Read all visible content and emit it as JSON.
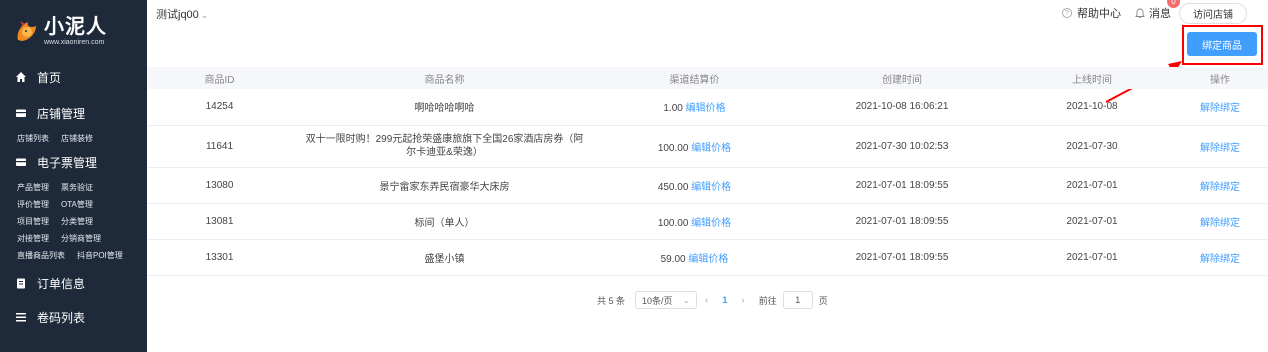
{
  "brand": {
    "name": "小泥人",
    "url": "www.xiaoniren.com"
  },
  "sidebar": {
    "home": "首页",
    "shop_section": {
      "label": "店铺管理",
      "subs": [
        "店铺列表",
        "店铺装修"
      ]
    },
    "ticket_section": {
      "label": "电子票管理",
      "subs": [
        [
          "产品管理",
          "票务验证"
        ],
        [
          "评价管理",
          "OTA管理"
        ],
        [
          "项目管理",
          "分类管理"
        ],
        [
          "对接管理",
          "分销商管理"
        ],
        [
          "直播商品列表",
          "抖音POI管理"
        ]
      ]
    },
    "order": "订单信息",
    "partial": "卷码列表"
  },
  "header": {
    "shop_name": "测试jq00",
    "help": "帮助中心",
    "messages": "消息",
    "badge": "0",
    "visit_shop": "访问店铺"
  },
  "actions": {
    "bind_product": "绑定商品"
  },
  "table": {
    "columns": [
      "商品ID",
      "商品名称",
      "渠道结算价",
      "创建时间",
      "上线时间",
      "操作"
    ],
    "edit_price": "编辑价格",
    "unbind": "解除绑定",
    "rows": [
      {
        "id": "14254",
        "name": "啊哈哈哈啊哈",
        "price": "1.00",
        "created": "2021-10-08 16:06:21",
        "online": "2021-10-08"
      },
      {
        "id": "11641",
        "name": "双十一限时购！299元起抢荣盛康旅旗下全国26家酒店房券（阿尔卡迪亚&荣逸）",
        "price": "100.00",
        "created": "2021-07-30 10:02:53",
        "online": "2021-07-30"
      },
      {
        "id": "13080",
        "name": "景宁畲家东弄民宿豪华大床房",
        "price": "450.00",
        "created": "2021-07-01 18:09:55",
        "online": "2021-07-01"
      },
      {
        "id": "13081",
        "name": "标间（单人）",
        "price": "100.00",
        "created": "2021-07-01 18:09:55",
        "online": "2021-07-01"
      },
      {
        "id": "13301",
        "name": "盛堡小镇",
        "price": "59.00",
        "created": "2021-07-01 18:09:55",
        "online": "2021-07-01"
      }
    ]
  },
  "pagination": {
    "total": "共 5 条",
    "page_size": "10条/页",
    "current_page": "1",
    "goto_label": "前往",
    "goto_value": "1",
    "page_suffix": "页"
  }
}
